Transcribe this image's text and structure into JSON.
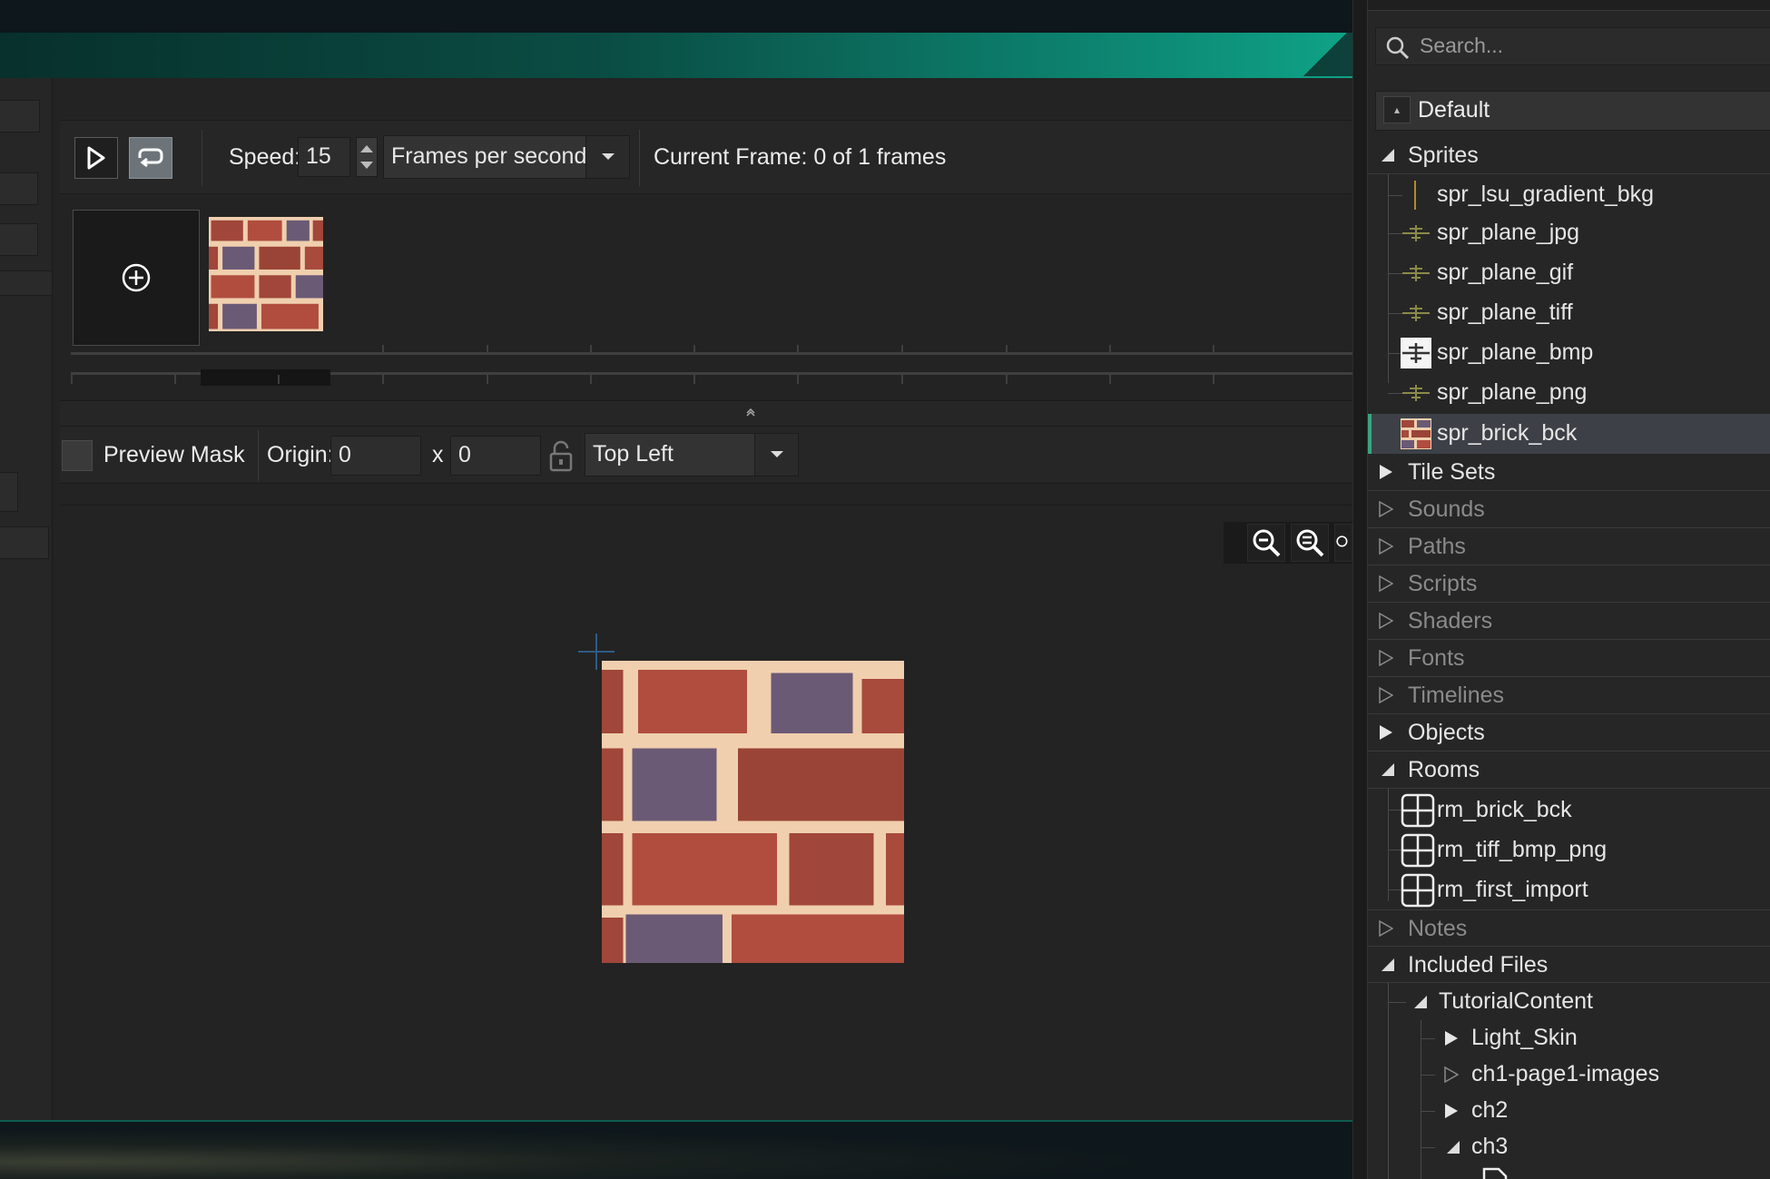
{
  "toolbar": {
    "speed_label": "Speed:",
    "speed_value": "15",
    "speed_unit": "Frames per second",
    "current_frame": "Current Frame: 0 of 1 frames"
  },
  "props": {
    "preview_mask_label": "Preview Mask",
    "origin_label": "Origin:",
    "origin_x": "0",
    "origin_sep": "x",
    "origin_y": "0",
    "origin_preset": "Top Left"
  },
  "resources": {
    "search_placeholder": "Search...",
    "default_label": "Default",
    "sprites": {
      "label": "Sprites",
      "items": [
        "spr_lsu_gradient_bkg",
        "spr_plane_jpg",
        "spr_plane_gif",
        "spr_plane_tiff",
        "spr_plane_bmp",
        "spr_plane_png",
        "spr_brick_bck"
      ]
    },
    "groups_a": [
      "Tile Sets",
      "Sounds",
      "Paths",
      "Scripts",
      "Shaders",
      "Fonts",
      "Timelines",
      "Objects"
    ],
    "rooms": {
      "label": "Rooms",
      "items": [
        "rm_brick_bck",
        "rm_tiff_bmp_png",
        "rm_first_import"
      ]
    },
    "notes_label": "Notes",
    "included_files": {
      "label": "Included Files",
      "tutorial": "TutorialContent",
      "children": [
        "Light_Skin",
        "ch1-page1-images",
        "ch2",
        "ch3"
      ]
    }
  },
  "colors": {
    "accent": "#0fa387",
    "selection": "#3d4147",
    "selection_marker": "#3aa37f",
    "brick_red": "#a0463a",
    "brick_purple": "#6b5a75",
    "mortar": "#f0cfae"
  }
}
